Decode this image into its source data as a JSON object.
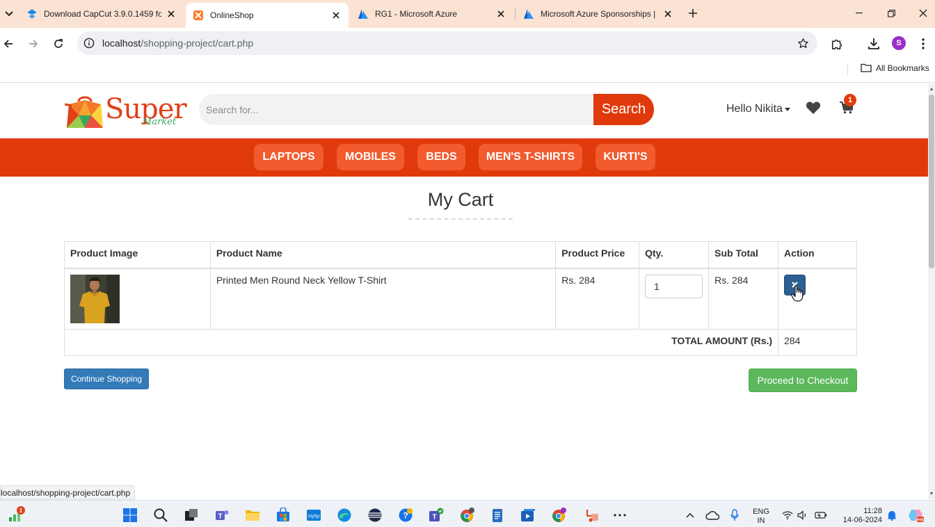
{
  "browser": {
    "tabs": [
      {
        "title": "Download CapCut 3.9.0.1459 fo",
        "icon": "capcut-icon"
      },
      {
        "title": "OnlineShop",
        "icon": "xampp-icon"
      },
      {
        "title": "RG1 - Microsoft Azure",
        "icon": "azure-icon"
      },
      {
        "title": "Microsoft Azure Sponsorships |",
        "icon": "azure-icon"
      }
    ],
    "url_host": "localhost",
    "url_path": "/shopping-project/cart.php",
    "profile_initial": "S",
    "bookmarks_label": "All Bookmarks",
    "status_url": "localhost/shopping-project/cart.php"
  },
  "site": {
    "logo_word": "Super",
    "logo_sub": "Market",
    "search_placeholder": "Search for...",
    "search_button": "Search",
    "user_greeting": "Hello Nikita",
    "cart_count": "1",
    "categories": [
      "LAPTOPS",
      "MOBILES",
      "BEDS",
      "MEN'S T-SHIRTS",
      "KURTI'S"
    ],
    "brand_color": "#e03a0c"
  },
  "cart": {
    "title": "My Cart",
    "headers": [
      "Product Image",
      "Product Name",
      "Product Price",
      "Qty.",
      "Sub Total",
      "Action"
    ],
    "rows": [
      {
        "name": "Printed Men Round Neck Yellow T-Shirt",
        "price": "Rs. 284",
        "qty": "1",
        "subtotal": "Rs. 284",
        "action_icon": "remove-icon"
      }
    ],
    "total_label": "TOTAL AMOUNT (Rs.)",
    "total_value": "284",
    "continue_label": "Continue Shopping",
    "checkout_label": "Proceed to Checkout"
  },
  "taskbar": {
    "widgets_badge": "1",
    "lang_top": "ENG",
    "lang_bottom": "IN",
    "time": "11:28",
    "date": "14-06-2024"
  }
}
